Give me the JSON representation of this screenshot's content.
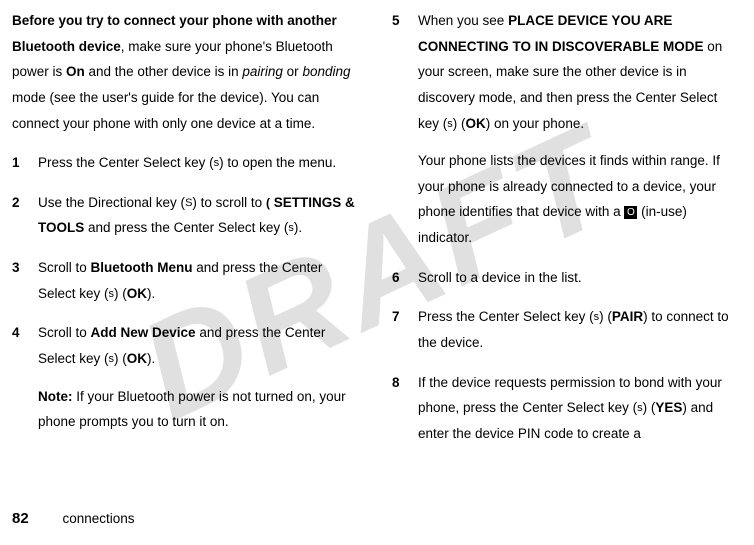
{
  "watermark": "DRAFT",
  "intro": {
    "bold_lead": "Before you try to connect your phone with another Bluetooth device",
    "text_part1": ", make sure your phone's Bluetooth power is ",
    "on_label": "On",
    "text_part2": " and the other device is in ",
    "pairing": "pairing",
    "text_part3": " or ",
    "bonding": "bonding",
    "text_part4": " mode (see the user's guide for the device). You can connect your phone with only one device at a time."
  },
  "left_steps": [
    {
      "num": "1",
      "fragments": [
        {
          "text": "Press the Center Select key (",
          "cls": ""
        },
        {
          "text": "s",
          "cls": "icon-key"
        },
        {
          "text": ") to open the menu.",
          "cls": ""
        }
      ]
    },
    {
      "num": "2",
      "fragments": [
        {
          "text": "Use the Directional key (",
          "cls": ""
        },
        {
          "text": "S",
          "cls": "icon-key"
        },
        {
          "text": ") to scroll to ",
          "cls": ""
        },
        {
          "text": "(",
          "cls": "icon-settings"
        },
        {
          "text": " SETTINGS & TOOLS",
          "cls": "condensed"
        },
        {
          "text": " and press the Center Select key (",
          "cls": ""
        },
        {
          "text": "s",
          "cls": "icon-key"
        },
        {
          "text": ").",
          "cls": ""
        }
      ]
    },
    {
      "num": "3",
      "fragments": [
        {
          "text": "Scroll to ",
          "cls": ""
        },
        {
          "text": "Bluetooth Menu",
          "cls": "condensed"
        },
        {
          "text": " and press the Center Select key (",
          "cls": ""
        },
        {
          "text": "s",
          "cls": "icon-key"
        },
        {
          "text": ") (",
          "cls": ""
        },
        {
          "text": "OK",
          "cls": "condensed"
        },
        {
          "text": ").",
          "cls": ""
        }
      ]
    },
    {
      "num": "4",
      "fragments": [
        {
          "text": "Scroll to ",
          "cls": ""
        },
        {
          "text": "Add New Device",
          "cls": "condensed"
        },
        {
          "text": " and press the Center Select key (",
          "cls": ""
        },
        {
          "text": "s",
          "cls": "icon-key"
        },
        {
          "text": ") (",
          "cls": ""
        },
        {
          "text": "OK",
          "cls": "condensed"
        },
        {
          "text": ").",
          "cls": ""
        }
      ],
      "note": {
        "label": "Note:",
        "text": " If your Bluetooth power is not turned on, your phone prompts you to turn it on."
      }
    }
  ],
  "right_steps": [
    {
      "num": "5",
      "fragments": [
        {
          "text": "When you see ",
          "cls": ""
        },
        {
          "text": "PLACE DEVICE YOU ARE CONNECTING TO IN DISCOVERABLE MODE",
          "cls": "small-caps"
        },
        {
          "text": " on your screen, make sure the other device is in discovery mode, and then press the Center Select key (",
          "cls": ""
        },
        {
          "text": "s",
          "cls": "icon-key"
        },
        {
          "text": ") (",
          "cls": ""
        },
        {
          "text": "OK",
          "cls": "condensed"
        },
        {
          "text": ") on your phone.",
          "cls": ""
        }
      ],
      "para2_fragments": [
        {
          "text": "Your phone lists the devices it finds within range. If your phone is already connected to a device, your phone identifies that device with a ",
          "cls": ""
        },
        {
          "text": "O",
          "cls": "icon-bt"
        },
        {
          "text": " (in-use) indicator.",
          "cls": ""
        }
      ]
    },
    {
      "num": "6",
      "fragments": [
        {
          "text": "Scroll to a device in the list.",
          "cls": ""
        }
      ]
    },
    {
      "num": "7",
      "fragments": [
        {
          "text": "Press the Center Select key (",
          "cls": ""
        },
        {
          "text": "s",
          "cls": "icon-key"
        },
        {
          "text": ") (",
          "cls": ""
        },
        {
          "text": "PAIR",
          "cls": "condensed"
        },
        {
          "text": ") to connect to the device.",
          "cls": ""
        }
      ]
    },
    {
      "num": "8",
      "fragments": [
        {
          "text": "If the device requests permission to bond with your phone, press the Center Select key (",
          "cls": ""
        },
        {
          "text": "s",
          "cls": "icon-key"
        },
        {
          "text": ") (",
          "cls": ""
        },
        {
          "text": "YES",
          "cls": "condensed"
        },
        {
          "text": ") and enter the device PIN code to create a",
          "cls": ""
        }
      ]
    }
  ],
  "footer": {
    "page": "82",
    "section": "connections"
  }
}
